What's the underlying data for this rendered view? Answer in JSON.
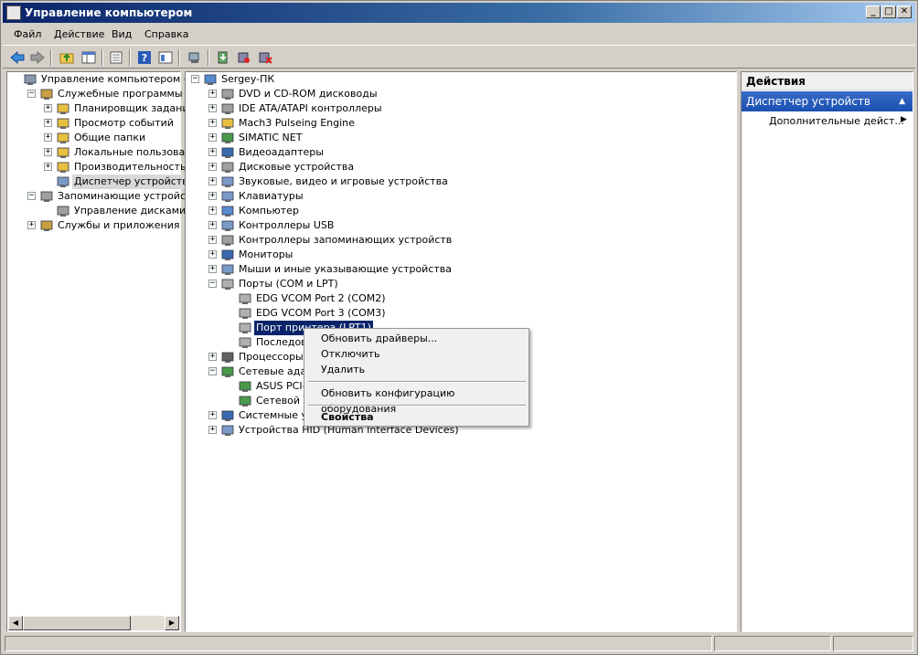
{
  "window": {
    "title": "Управление компьютером",
    "min": "_",
    "max": "□",
    "close": "✕"
  },
  "menu": [
    "Файл",
    "Действие",
    "Вид",
    "Справка"
  ],
  "left_tree": [
    {
      "label": "Управление компьютером (лока",
      "level": 0,
      "exp": ""
    },
    {
      "label": "Служебные программы",
      "level": 1,
      "exp": "−"
    },
    {
      "label": "Планировщик заданий",
      "level": 2,
      "exp": "+"
    },
    {
      "label": "Просмотр событий",
      "level": 2,
      "exp": "+"
    },
    {
      "label": "Общие папки",
      "level": 2,
      "exp": "+"
    },
    {
      "label": "Локальные пользовател",
      "level": 2,
      "exp": "+"
    },
    {
      "label": "Производительность",
      "level": 2,
      "exp": "+"
    },
    {
      "label": "Диспетчер устройств",
      "level": 2,
      "exp": "",
      "selected": true
    },
    {
      "label": "Запоминающие устройства",
      "level": 1,
      "exp": "−"
    },
    {
      "label": "Управление дисками",
      "level": 2,
      "exp": ""
    },
    {
      "label": "Службы и приложения",
      "level": 1,
      "exp": "+"
    }
  ],
  "device_tree": [
    {
      "label": "Sergey-ПК",
      "level": 0,
      "exp": "−"
    },
    {
      "label": "DVD и CD-ROM дисководы",
      "level": 1,
      "exp": "+"
    },
    {
      "label": "IDE ATA/ATAPI контроллеры",
      "level": 1,
      "exp": "+"
    },
    {
      "label": "Mach3 Pulseing Engine",
      "level": 1,
      "exp": "+"
    },
    {
      "label": "SIMATIC NET",
      "level": 1,
      "exp": "+"
    },
    {
      "label": "Видеоадаптеры",
      "level": 1,
      "exp": "+"
    },
    {
      "label": "Дисковые устройства",
      "level": 1,
      "exp": "+"
    },
    {
      "label": "Звуковые, видео и игровые устройства",
      "level": 1,
      "exp": "+"
    },
    {
      "label": "Клавиатуры",
      "level": 1,
      "exp": "+"
    },
    {
      "label": "Компьютер",
      "level": 1,
      "exp": "+"
    },
    {
      "label": "Контроллеры USB",
      "level": 1,
      "exp": "+"
    },
    {
      "label": "Контроллеры запоминающих устройств",
      "level": 1,
      "exp": "+"
    },
    {
      "label": "Мониторы",
      "level": 1,
      "exp": "+"
    },
    {
      "label": "Мыши и иные указывающие устройства",
      "level": 1,
      "exp": "+"
    },
    {
      "label": "Порты (COM и LPT)",
      "level": 1,
      "exp": "−"
    },
    {
      "label": "EDG VCOM Port 2 (COM2)",
      "level": 2,
      "exp": ""
    },
    {
      "label": "EDG VCOM Port 3 (COM3)",
      "level": 2,
      "exp": ""
    },
    {
      "label": "Порт принтера (LPT1)",
      "level": 2,
      "exp": "",
      "selected": true
    },
    {
      "label": "Последов",
      "level": 2,
      "exp": ""
    },
    {
      "label": "Процессоры",
      "level": 1,
      "exp": "+"
    },
    {
      "label": "Сетевые ада",
      "level": 1,
      "exp": "−"
    },
    {
      "label": "ASUS PCI-",
      "level": 2,
      "exp": ""
    },
    {
      "label": "Сетевой м",
      "level": 2,
      "exp": ""
    },
    {
      "label": "Системные ус",
      "level": 1,
      "exp": "+"
    },
    {
      "label": "Устройства HID (Human Interface Devices)",
      "level": 1,
      "exp": "+"
    }
  ],
  "actions": {
    "header": "Действия",
    "section": "Диспетчер устройств",
    "more": "Дополнительные дейст..."
  },
  "context_menu": [
    "Обновить драйверы...",
    "Отключить",
    "Удалить",
    "Обновить конфигурацию оборудования",
    "Свойства"
  ]
}
